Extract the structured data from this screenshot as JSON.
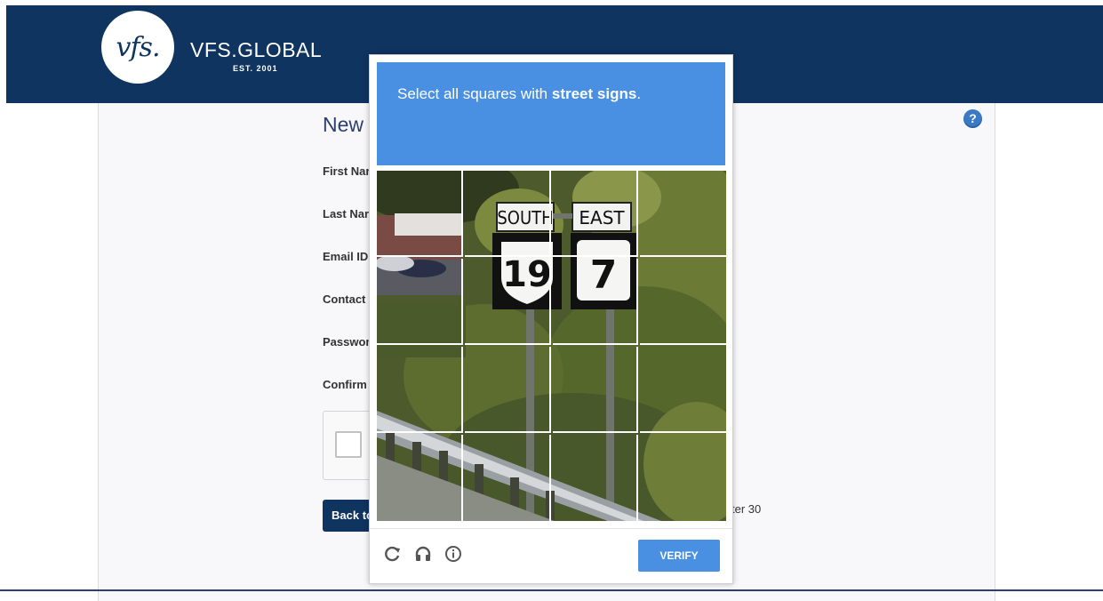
{
  "header": {
    "logo_mark": "vfs.",
    "brand": "VFS.GLOBAL",
    "est": "EST. 2001",
    "bg_color": "#0f3460"
  },
  "form": {
    "title": "New",
    "help_icon": "?",
    "labels": [
      "First Nar",
      "Last Nar",
      "Email ID",
      "Contact",
      "Passwor",
      "Confirm"
    ],
    "back_button": "Back to",
    "side_text": "ter 30"
  },
  "captcha": {
    "instruction_prefix": "Select all squares with ",
    "instruction_target": "street signs",
    "instruction_suffix": ".",
    "sign_south": "SOUTH",
    "sign_east": "EAST",
    "route_19": "19",
    "route_7": "7",
    "verify": "VERIFY",
    "icons": [
      "reload-icon",
      "headphones-icon",
      "info-icon"
    ],
    "accent_color": "#4a90e2"
  }
}
